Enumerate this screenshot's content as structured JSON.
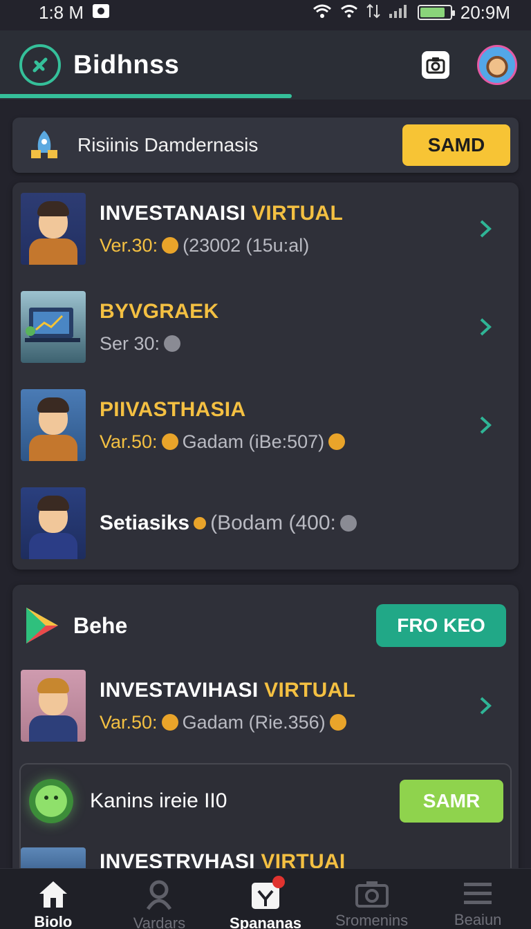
{
  "status_bar": {
    "left_time": "1:8 M",
    "right_time": "20:9M",
    "battery_level": 0.85
  },
  "header": {
    "app_title": "Bidhnss",
    "brand_color": "#35c09a",
    "tab_progress": 0.55
  },
  "promo": {
    "text": "Risiinis Damdernasis",
    "button_label": "SAMD"
  },
  "investments": [
    {
      "title_white": "INVESTANAISI",
      "title_accent": "VIRTUAL",
      "sub_label": "Ver.30:",
      "sub_rest": "(23002  (15u:al)"
    },
    {
      "title_yellow": "BYVGRAEK",
      "sub_label": "Ser 30:",
      "sub_rest": ""
    },
    {
      "title_yellow": "PIIVASTHASIA",
      "sub_label": "Var.50:",
      "sub_rest": "Gadam  (iBe:507)"
    },
    {
      "title_white": "Setiasiks",
      "sub_rest": "(Bodam  (400:"
    }
  ],
  "section2": {
    "title": "Behe",
    "button_label": "FRO KEO",
    "item": {
      "title_white": "INVESTAVIHASI",
      "title_accent": "VIRTUAL",
      "sub_label": "Var.50:",
      "sub_rest": "Gadam  (Rie.356)"
    },
    "subcard": {
      "title": "Kanins ireie II0",
      "button_label": "SAMR",
      "item_title_white": "INVESTRVHASI",
      "item_title_accent": "VIRTUAI"
    }
  },
  "bottom_nav": [
    {
      "label": "Biolo",
      "icon": "home-icon",
      "active": true
    },
    {
      "label": "Vardars",
      "icon": "person-icon",
      "active": false
    },
    {
      "label": "Spananas",
      "icon": "shopping-bag-icon",
      "active": true
    },
    {
      "label": "Sromenins",
      "icon": "camera-icon",
      "active": false
    },
    {
      "label": "Beaiun",
      "icon": "menu-icon",
      "active": false
    }
  ]
}
